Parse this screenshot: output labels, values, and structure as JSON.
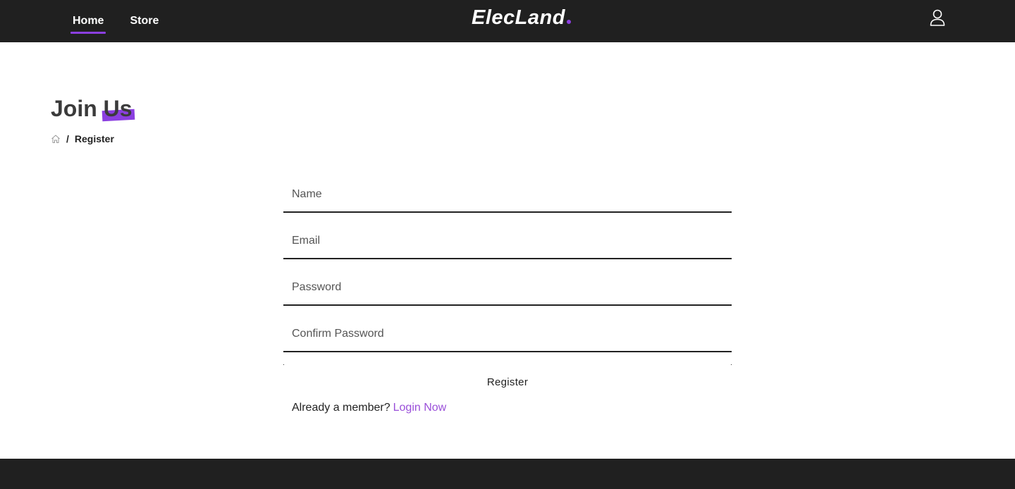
{
  "header": {
    "nav": [
      {
        "label": "Home",
        "active": true
      },
      {
        "label": "Store",
        "active": false
      }
    ],
    "logo": "ElecLand",
    "user_icon": "user-icon"
  },
  "page": {
    "title_main": "Join",
    "title_accent": "Us",
    "breadcrumb": {
      "home_icon": "home-icon",
      "separator": "/",
      "current": "Register"
    }
  },
  "form": {
    "name_placeholder": "Name",
    "email_placeholder": "Email",
    "password_placeholder": "Password",
    "confirm_password_placeholder": "Confirm Password",
    "name_value": "",
    "email_value": "",
    "password_value": "",
    "confirm_password_value": "",
    "submit_label": "Register",
    "login_prompt": "Already a member?",
    "login_link": "Login Now"
  },
  "colors": {
    "accent": "#8b3fe0",
    "link": "#9a4fd9",
    "bar": "#202020"
  }
}
